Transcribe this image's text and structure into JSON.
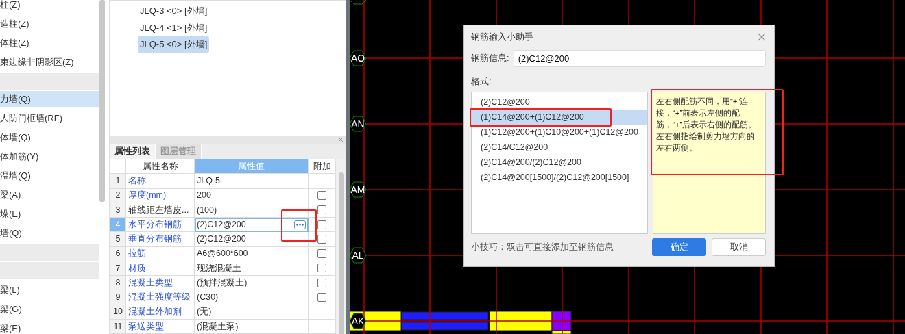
{
  "sidebar": {
    "items": [
      {
        "kind": "item",
        "label": "柱(Z)",
        "selected": false
      },
      {
        "kind": "item",
        "label": "造柱(Z)",
        "selected": false
      },
      {
        "kind": "item",
        "label": "体柱(Z)",
        "selected": false
      },
      {
        "kind": "item",
        "label": "束边缘非阴影区(Z)",
        "selected": false
      },
      {
        "kind": "group"
      },
      {
        "kind": "item",
        "label": "力墙(Q)",
        "selected": true
      },
      {
        "kind": "item",
        "label": "人防门框墙(RF)",
        "selected": false
      },
      {
        "kind": "item",
        "label": "体墙(Q)",
        "selected": false
      },
      {
        "kind": "item",
        "label": "体加筋(Y)",
        "selected": false
      },
      {
        "kind": "item",
        "label": "温墙(Q)",
        "selected": false
      },
      {
        "kind": "item",
        "label": "梁(A)",
        "selected": false
      },
      {
        "kind": "item",
        "label": "垛(E)",
        "selected": false
      },
      {
        "kind": "item",
        "label": "墙(Q)",
        "selected": false
      },
      {
        "kind": "group"
      },
      {
        "kind": "group"
      },
      {
        "kind": "item",
        "label": "梁(L)",
        "selected": false
      },
      {
        "kind": "item",
        "label": "梁(G)",
        "selected": false
      },
      {
        "kind": "item",
        "label": "梁(E)",
        "selected": false
      }
    ]
  },
  "tree": {
    "items": [
      {
        "label": "JLQ-3 <0> [外墙]",
        "selected": false
      },
      {
        "label": "JLQ-4 <1> [外墙]",
        "selected": false
      },
      {
        "label": "JLQ-5 <0> [外墙]",
        "selected": true
      }
    ]
  },
  "properties": {
    "tabs": [
      {
        "label": "属性列表",
        "selected": true
      },
      {
        "label": "图层管理",
        "selected": false
      }
    ],
    "table": {
      "columns": [
        "属性名称",
        "属性值",
        "附加"
      ],
      "rows": [
        {
          "index": "1",
          "name": "名称",
          "value": "JLQ-5",
          "public": true,
          "selected": false,
          "kind": "plain"
        },
        {
          "index": "2",
          "name": "厚度(mm)",
          "value": "200",
          "public": true,
          "selected": false,
          "kind": "checkbox",
          "checked": false
        },
        {
          "index": "3",
          "name": "轴线距左墙皮...",
          "value": "(100)",
          "public": false,
          "selected": false,
          "kind": "checkbox",
          "checked": false
        },
        {
          "index": "4",
          "name": "水平分布钢筋",
          "value": "(2)C12@200",
          "public": true,
          "selected": true,
          "kind": "checkbox",
          "checked": false
        },
        {
          "index": "5",
          "name": "垂直分布钢筋",
          "value": "(2)C12@200",
          "public": true,
          "selected": false,
          "kind": "checkbox",
          "checked": false
        },
        {
          "index": "6",
          "name": "拉筋",
          "value": "A6@600*600",
          "public": true,
          "selected": false,
          "kind": "checkbox",
          "checked": false
        },
        {
          "index": "7",
          "name": "材质",
          "value": "现浇混凝土",
          "public": true,
          "selected": false,
          "kind": "checkbox",
          "checked": false
        },
        {
          "index": "8",
          "name": "混凝土类型",
          "value": "(预拌混凝土)",
          "public": true,
          "selected": false,
          "kind": "checkbox",
          "checked": false
        },
        {
          "index": "9",
          "name": "混凝土强度等级",
          "value": "(C30)",
          "public": true,
          "selected": false,
          "kind": "checkbox",
          "checked": false
        },
        {
          "index": "10",
          "name": "混凝土外加剂",
          "value": "(无)",
          "public": true,
          "selected": false,
          "kind": "plain"
        },
        {
          "index": "11",
          "name": "泵送类型",
          "value": "(混凝土泵)",
          "public": true,
          "selected": false,
          "kind": "plain"
        }
      ]
    }
  },
  "canvas": {
    "axes": [
      {
        "label": "AO"
      },
      {
        "label": "AN"
      },
      {
        "label": "AM"
      },
      {
        "label": "AL"
      },
      {
        "label": "AK"
      }
    ]
  },
  "dialog": {
    "title": "钢筋输入小助手",
    "info_label": "钢筋信息:",
    "info_value": "(2)C12@200",
    "format_label": "格式:",
    "formats": [
      {
        "label": "(2)C12@200",
        "selected": false
      },
      {
        "label": "(1)C14@200+(1)C12@200",
        "selected": true
      },
      {
        "label": "(1)C12@200+(1)C10@200+(1)C12@200",
        "selected": false
      },
      {
        "label": "(2)C14/C12@200",
        "selected": false
      },
      {
        "label": "(2)C14@200/(2)C12@200",
        "selected": false
      },
      {
        "label": "(2)C14@200[1500]/(2)C12@200[1500]",
        "selected": false
      }
    ],
    "description": "左右侧配筋不同，用“+”连接，“+”前表示左侧的配筋，“+”后表示右侧的配筋。左右侧指绘制剪力墙方向的左右两侧。",
    "tip": "小技巧：双击可直接添加至钢筋信息",
    "buttons": [
      {
        "label": "确定",
        "kind": "primary"
      },
      {
        "label": "取消",
        "kind": "secondary"
      }
    ]
  }
}
